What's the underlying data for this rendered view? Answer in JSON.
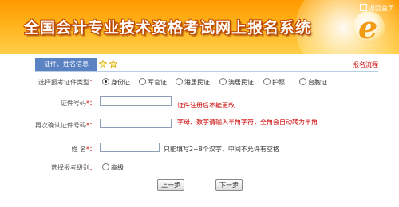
{
  "header": {
    "title": "全国会计专业技术资格考试网上报名系统",
    "back_link": "返回首页"
  },
  "tabs": {
    "active": "证件、姓名信息",
    "process_link": "报名流程"
  },
  "form": {
    "id_type": {
      "label": "选择报考证件类型",
      "options": [
        {
          "label": "身份证",
          "selected": true
        },
        {
          "label": "军官证",
          "selected": false
        },
        {
          "label": "港居民证",
          "selected": false
        },
        {
          "label": "澳居民证",
          "selected": false
        },
        {
          "label": "护照",
          "selected": false
        },
        {
          "label": "台胞证",
          "selected": false
        }
      ]
    },
    "id_number": {
      "label": "证件号码",
      "value": "",
      "hint": "证件注册后不能更改"
    },
    "id_confirm": {
      "label": "再次确认证件号码",
      "value": "",
      "hint": "字母、数字请输入半角字符，全角会自动转为半角"
    },
    "name": {
      "label": "姓  名",
      "value": "",
      "hint": "只能填写2~8个汉字，中间不允许有空格"
    },
    "level": {
      "label": "选择报考级别",
      "option": "高级",
      "selected": false
    }
  },
  "buttons": {
    "prev": "上一步",
    "next": "下一步"
  }
}
